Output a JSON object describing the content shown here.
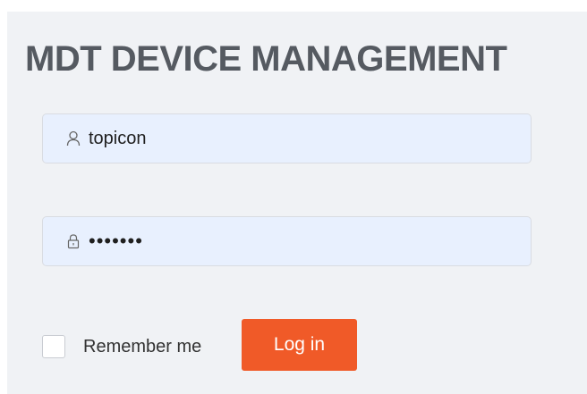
{
  "app": {
    "title": "MDT DEVICE MANAGEMENT"
  },
  "login_form": {
    "username": {
      "value": "topicon",
      "icon": "user-icon"
    },
    "password": {
      "value": "•••••••",
      "icon": "lock-icon"
    },
    "remember_me": {
      "label": "Remember me",
      "checked": false
    },
    "login_button": {
      "label": "Log in"
    }
  },
  "colors": {
    "background_panel": "#f0f2f5",
    "input_fill": "#e8f0fe",
    "title_text": "#555a61",
    "accent_button": "#f05a28"
  }
}
